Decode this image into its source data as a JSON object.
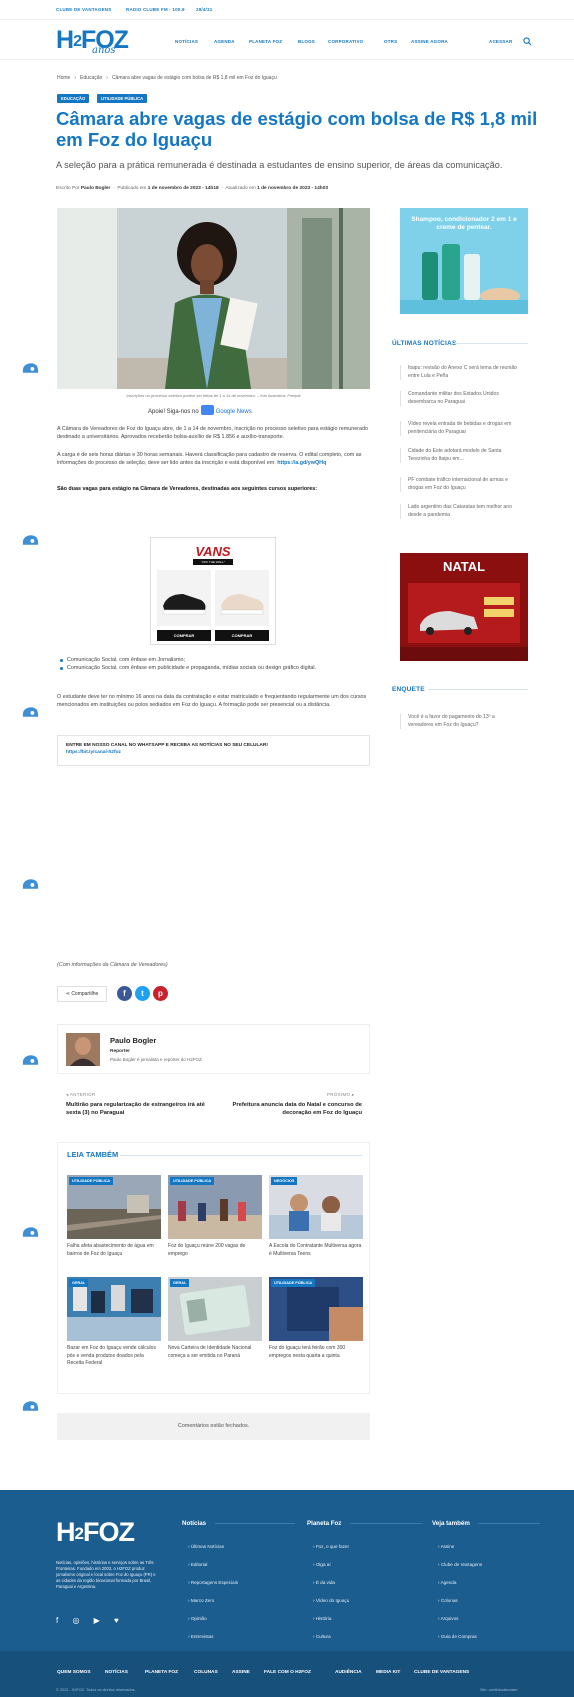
{
  "topbar": {
    "left": "CLUBE DE VANTAGENS",
    "mid": "RADIO CLUBE FM - 100.9",
    "right": "28/4/31"
  },
  "header": {
    "logo": "H2FOZ",
    "logo_sub": "anos",
    "nav": [
      "NOTÍCIAS",
      "AGENDA",
      "PLANETA FOZ",
      "BLOGS",
      "CORPORATIVO",
      "OTRS",
      "ASSINE AGORA"
    ],
    "login": "ACESSAR"
  },
  "breadcrumb": [
    "Home",
    "›",
    "Educação",
    "›",
    "Câmara abre vagas de estágio com bolsa de R$ 1,8 mil em Foz do Iguaçu"
  ],
  "tags": [
    "EDUCAÇÃO",
    "UTILIDADE PÚBLICA"
  ],
  "article": {
    "title": "Câmara abre vagas de estágio com bolsa de R$ 1,8 mil em Foz do Iguaçu",
    "subtitle": "A seleção para a prática remunerada é destinada a estudantes de ensino superior, de áreas da comunicação.",
    "meta": {
      "by_label": "Escrito Por",
      "author": "Paulo Bogler",
      "published_label": "Publicado em",
      "published": "1 de novembro de 2023 - 14h18",
      "updated_label": "Atualizado em",
      "updated": "1 de novembro de 2023 - 14h03"
    },
    "caption": "Inscrições no processo seletivo podem ser feitas de 1 a 14 de novembro. – foto ilustrativa: Freepik",
    "gnews": {
      "prefix": "Apoie! Siga-nos no",
      "label": "Google News"
    },
    "p1": "A Câmara de Vereadores de Foz do Iguaçu abre, de 1 a 14 de novembro, inscrição no processo seletivo para estágio remunerado destinado a universitários. Aprovados receberão bolsa-auxílio de R$ 1.856 e auxílio-transporte.",
    "p2": "A carga é de seis horas diárias e 30 horas semanais. Haverá classificação para cadastro de reserva. O edital completo, com as informações do processo de seleção, deve ser lido antes da inscrição e está disponível em:",
    "p2_link": "https://a.gd/ywQHq",
    "p3": "São duas vagas para estágio na Câmara de Vereadores, destinadas aos seguintes cursos superiores:",
    "ad": {
      "brand": "VANS",
      "tagline": "\"OFF THE WALL\"",
      "cta1": "COMPRAR",
      "cta2": "COMPRAR"
    },
    "bullets": [
      "Comunicação Social, com ênfase em Jornalismo;",
      "Comunicação Social, com ênfase em publicidade e propaganda, mídias sociais ou design gráfico digital."
    ],
    "p4": "O estudante deve ter no mínimo 16 anos na data da contratação e estar matriculado e frequentando regularmente um dos cursos mencionados em instituições ou polos sediados em Foz do Iguaçu. A formação pode ser presencial ou a distância.",
    "whatsapp": {
      "text": "ENTRE EM NOSSO CANAL NO WHATSAPP E RECEBA AS NOTÍCIAS NO SEU CELULAR!",
      "link": "https://bit.ly/canal-h2foz"
    },
    "source": "(Com informações da Câmara de Vereadores)",
    "share_label": "Compartilhe"
  },
  "author_box": {
    "name": "Paulo Bogler",
    "role": "Reporter",
    "desc": "Paulo Bogler é jornalista e repórter do H2FOZ."
  },
  "post_nav": {
    "prev_label": "◂  ANTERIOR",
    "prev_title": "Multirão para regularização de estrangeiros irá até sexta (3) no Paraguai",
    "next_label": "PRÓXIMO  ▸",
    "next_title": "Prefeitura anuncia data do Natal e concurso de decoração em Foz do Iguaçu"
  },
  "related": {
    "heading": "LEIA TAMBÉM",
    "items": [
      {
        "cat": "UTILIDADE PÚBLICA",
        "title": "Falha afeta abastecimento de água em bairros de Foz do Iguaçu"
      },
      {
        "cat": "UTILIDADE PÚBLICA",
        "title": "Foz do Iguaçu reúne 200 vagas de emprego"
      },
      {
        "cat": "NEGÓCIOS",
        "title": "A Escola do Contratante Multiversa agora é Multiversa Teens"
      },
      {
        "cat": "GERAL",
        "title": "Bazar em Foz do Iguaçu vende cálculos pós e venda produtos doados pela Receita Federal"
      },
      {
        "cat": "GERAL",
        "title": "Nova Carteira de Identidade Nacional começa a ser emitida no Paraná"
      },
      {
        "cat": "UTILIDADE PÚBLICA",
        "title": "Foz do Iguaçu terá feirão com 300 empregos nesta quarta a quinta"
      }
    ]
  },
  "comments_closed": "Comentários estão fechados.",
  "sidebar": {
    "ad_text": "Shampoo, condicionador 2 em 1 e creme de pentear.",
    "latest_heading": "ÚLTIMAS NOTÍCIAS",
    "latest": [
      "Itaipu: revisão do Anexo C será tema de reunião entre Lula e Peña",
      "Comandante militar dos Estados Unidos desembarca no Paraguai",
      "Vídeo revela entrada de bebidas e drogas em penitenciária do Paraguai",
      "Cidade do Este adotará modelo de Santa Terezinha do Itaipu em...",
      "PF combate tráfico internacional de armas e drogas em Foz do Iguaçu",
      "Lado argentino das Cataratas tem melhor ano desde a pandemia"
    ],
    "ad2_title": "NATAL",
    "poll_heading": "ENQUETE",
    "poll": "Você é a favor do pagamento do 13º a vereadores em Foz do Iguaçu?"
  },
  "footer": {
    "logo": "H2FOZ",
    "desc": "Notícias, opiniões, histórias e serviços sobre as Três Fronteiras. Fundado em 2003, o H2FOZ produz jornalismo original e local sobre Foz do Iguaçu (PR) e as cidades da região binacional formada por Brasil, Paraguai e Argentina.",
    "social": "f ◎ ▶ ♥",
    "cols": [
      {
        "title": "Notícias",
        "links": [
          "Últimas Notícias",
          "Editorial",
          "Reportagens Especiais",
          "Marco Zero",
          "Opinião",
          "Entrevistas"
        ]
      },
      {
        "title": "Planeta Foz",
        "links": [
          "Foz, o que fazer",
          "Olga aí",
          "É da vida",
          "Vídeo do Iguaçu",
          "História",
          "Cultura"
        ]
      },
      {
        "title": "Veja também",
        "links": [
          "Assine",
          "Clube de Vantagens",
          "Agenda",
          "Colunas",
          "Arquivos",
          "Guia de Compras"
        ]
      }
    ],
    "nav": [
      "QUEM SOMOS",
      "NOTÍCIAS",
      "PLANETA FOZ",
      "COLUNAS",
      "ASSINE",
      "FALE COM O H2FOZ",
      "AUDIÊNCIA",
      "MEDIA KIT",
      "CLUBE DE VANTAGENS"
    ],
    "copyright": "© 2023 - H2FOZ. Todos os direitos reservados.",
    "credit": "Site: cantinhoabooster"
  },
  "colors": {
    "brand": "#1477c3",
    "footer": "#1c5d8f"
  }
}
